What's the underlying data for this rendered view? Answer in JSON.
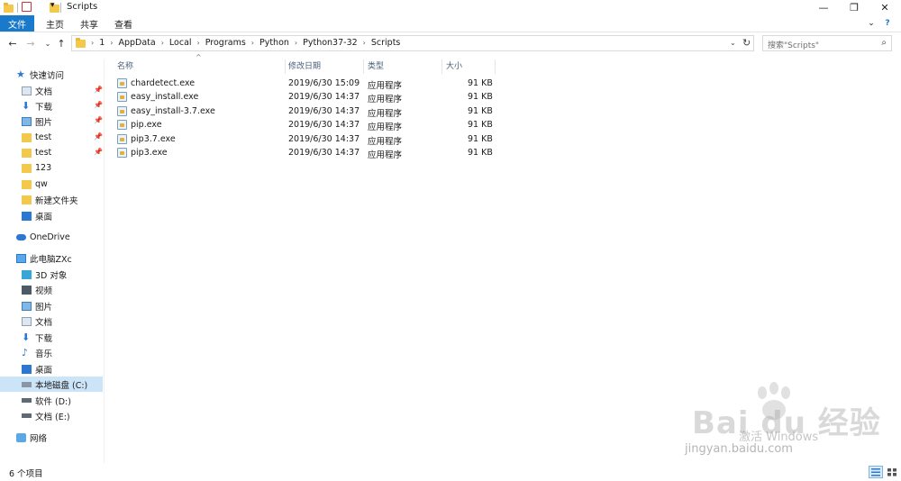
{
  "window": {
    "title": "Scripts",
    "minimize": "—",
    "restore": "❐",
    "close": "✕"
  },
  "ribbon": {
    "tabs": [
      {
        "label": "文件"
      },
      {
        "label": "主页"
      },
      {
        "label": "共享"
      },
      {
        "label": "查看"
      }
    ]
  },
  "address": {
    "crumbs": [
      "1",
      "AppData",
      "Local",
      "Programs",
      "Python",
      "Python37-32",
      "Scripts"
    ],
    "search_placeholder": "搜索\"Scripts\""
  },
  "sidebar": {
    "quick_access": "快速访问",
    "quick_items": [
      {
        "label": "文档",
        "pinned": true,
        "icon": "documents-icon"
      },
      {
        "label": "下载",
        "pinned": true,
        "icon": "download-icon"
      },
      {
        "label": "图片",
        "pinned": true,
        "icon": "pictures-icon"
      },
      {
        "label": "test",
        "pinned": true,
        "icon": "folder-icon"
      },
      {
        "label": "test",
        "pinned": true,
        "icon": "folder-icon"
      },
      {
        "label": "123",
        "pinned": false,
        "icon": "folder-icon"
      },
      {
        "label": "qw",
        "pinned": false,
        "icon": "folder-icon"
      },
      {
        "label": "新建文件夹",
        "pinned": false,
        "icon": "folder-icon"
      },
      {
        "label": "桌面",
        "pinned": false,
        "icon": "desktop-icon"
      }
    ],
    "onedrive": "OneDrive",
    "this_pc": "此电脑ZXc",
    "pc_items": [
      {
        "label": "3D 对象",
        "icon": "3d-objects-icon"
      },
      {
        "label": "视频",
        "icon": "videos-icon"
      },
      {
        "label": "图片",
        "icon": "pictures-icon"
      },
      {
        "label": "文档",
        "icon": "documents-icon"
      },
      {
        "label": "下载",
        "icon": "download-icon"
      },
      {
        "label": "音乐",
        "icon": "music-icon"
      },
      {
        "label": "桌面",
        "icon": "desktop-icon"
      },
      {
        "label": "本地磁盘 (C:)",
        "icon": "system-drive-icon",
        "selected": true
      },
      {
        "label": "软件 (D:)",
        "icon": "drive-icon"
      },
      {
        "label": "文档 (E:)",
        "icon": "drive-icon"
      }
    ],
    "network": "网络"
  },
  "columns": {
    "name": "名称",
    "modified": "修改日期",
    "type": "类型",
    "size": "大小"
  },
  "files": [
    {
      "name": "chardetect.exe",
      "modified": "2019/6/30 15:09",
      "type": "应用程序",
      "size": "91 KB"
    },
    {
      "name": "easy_install.exe",
      "modified": "2019/6/30 14:37",
      "type": "应用程序",
      "size": "91 KB"
    },
    {
      "name": "easy_install-3.7.exe",
      "modified": "2019/6/30 14:37",
      "type": "应用程序",
      "size": "91 KB"
    },
    {
      "name": "pip.exe",
      "modified": "2019/6/30 14:37",
      "type": "应用程序",
      "size": "91 KB"
    },
    {
      "name": "pip3.7.exe",
      "modified": "2019/6/30 14:37",
      "type": "应用程序",
      "size": "91 KB"
    },
    {
      "name": "pip3.exe",
      "modified": "2019/6/30 14:37",
      "type": "应用程序",
      "size": "91 KB"
    }
  ],
  "status": {
    "item_count": "6 个项目"
  },
  "watermark": {
    "brand": "Bai du 经验",
    "activate": "激活 Windows",
    "url": "jingyan.baidu.com"
  },
  "colors": {
    "accent": "#1979ca",
    "selected": "#cce4f7",
    "folder": "#f4c84b"
  }
}
